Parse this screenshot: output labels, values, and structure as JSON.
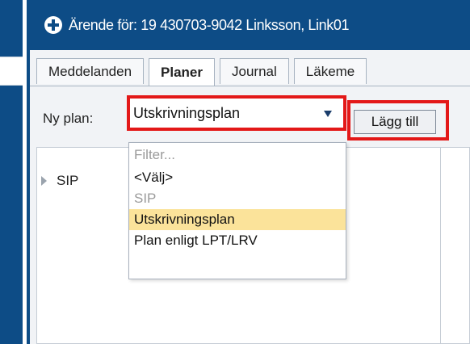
{
  "window": {
    "title": "Ärende för: 19 430703-9042 Linksson, Link01"
  },
  "tabs": [
    {
      "label": "Meddelanden",
      "active": false
    },
    {
      "label": "Planer",
      "active": true
    },
    {
      "label": "Journal",
      "active": false
    },
    {
      "label": "Läkeme",
      "active": false
    }
  ],
  "plan": {
    "label": "Ny plan:",
    "selected_value": "Utskrivningsplan",
    "add_button_label": "Lägg till"
  },
  "dropdown": {
    "filter_placeholder": "Filter...",
    "options": [
      {
        "label": "<Välj>",
        "state": "normal"
      },
      {
        "label": "SIP",
        "state": "disabled"
      },
      {
        "label": "Utskrivningsplan",
        "state": "selected"
      },
      {
        "label": "Plan enligt LPT/LRV",
        "state": "normal"
      }
    ]
  },
  "tree": {
    "items": [
      {
        "label": "SIP"
      }
    ]
  },
  "colors": {
    "title_bar": "#0d4c86",
    "highlight_outline": "#e31818",
    "selected_option": "#fbe39a"
  }
}
